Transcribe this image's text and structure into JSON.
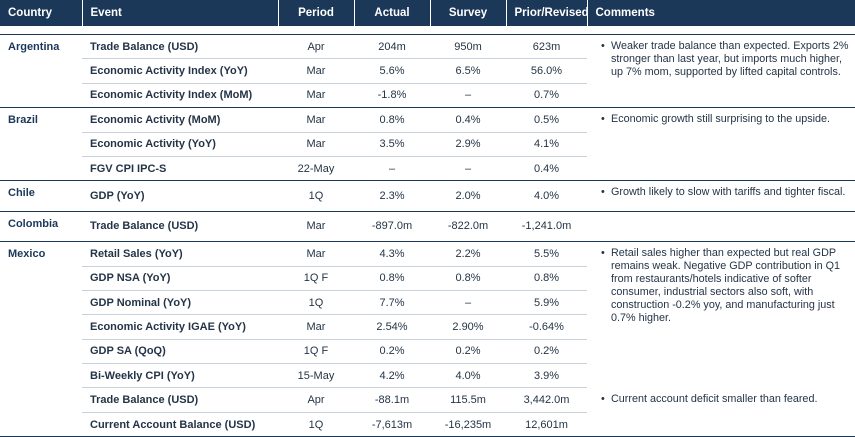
{
  "headers": {
    "country": "Country",
    "event": "Event",
    "period": "Period",
    "actual": "Actual",
    "survey": "Survey",
    "prior": "Prior/Revised",
    "comments": "Comments"
  },
  "groups": [
    {
      "country": "Argentina",
      "rows": [
        {
          "event": "Trade Balance (USD)",
          "period": "Apr",
          "actual": "204m",
          "survey": "950m",
          "prior": "623m"
        },
        {
          "event": "Economic Activity Index (YoY)",
          "period": "Mar",
          "actual": "5.6%",
          "survey": "6.5%",
          "prior": "56.0%"
        },
        {
          "event": "Economic Activity Index (MoM)",
          "period": "Mar",
          "actual": "-1.8%",
          "survey": "–",
          "prior": "0.7%"
        }
      ],
      "comments": [
        "Weaker trade balance than expected. Exports 2% stronger than last year, but imports much higher, up 7% mom, supported by lifted capital controls."
      ]
    },
    {
      "country": "Brazil",
      "rows": [
        {
          "event": "Economic Activity (MoM)",
          "period": "Mar",
          "actual": "0.8%",
          "survey": "0.4%",
          "prior": "0.5%"
        },
        {
          "event": "Economic Activity (YoY)",
          "period": "Mar",
          "actual": "3.5%",
          "survey": "2.9%",
          "prior": "4.1%"
        },
        {
          "event": "FGV CPI IPC-S",
          "period": "22-May",
          "actual": "–",
          "survey": "–",
          "prior": "0.4%"
        }
      ],
      "comments": [
        "Economic growth still surprising to the upside."
      ]
    },
    {
      "country": "Chile",
      "rows": [
        {
          "event": "GDP (YoY)",
          "period": "1Q",
          "actual": "2.3%",
          "survey": "2.0%",
          "prior": "4.0%"
        }
      ],
      "comments": [
        "Growth likely to slow with tariffs and tighter fiscal."
      ]
    },
    {
      "country": "Colombia",
      "rows": [
        {
          "event": "Trade Balance (USD)",
          "period": "Mar",
          "actual": "-897.0m",
          "survey": "-822.0m",
          "prior": "-1,241.0m"
        }
      ],
      "comments": []
    },
    {
      "country": "Mexico",
      "rows": [
        {
          "event": "Retail Sales (YoY)",
          "period": "Mar",
          "actual": "4.3%",
          "survey": "2.2%",
          "prior": "5.5%"
        },
        {
          "event": "GDP NSA (YoY)",
          "period": "1Q F",
          "actual": "0.8%",
          "survey": "0.8%",
          "prior": "0.8%"
        },
        {
          "event": "GDP Nominal (YoY)",
          "period": "1Q",
          "actual": "7.7%",
          "survey": "–",
          "prior": "5.9%"
        },
        {
          "event": "Economic Activity IGAE (YoY)",
          "period": "Mar",
          "actual": "2.54%",
          "survey": "2.90%",
          "prior": "-0.64%"
        },
        {
          "event": "GDP SA (QoQ)",
          "period": "1Q F",
          "actual": "0.2%",
          "survey": "0.2%",
          "prior": "0.2%"
        },
        {
          "event": "Bi-Weekly CPI (YoY)",
          "period": "15-May",
          "actual": "4.2%",
          "survey": "4.0%",
          "prior": "3.9%"
        },
        {
          "event": "Trade Balance (USD)",
          "period": "Apr",
          "actual": "-88.1m",
          "survey": "115.5m",
          "prior": "3,442.0m"
        },
        {
          "event": "Current Account Balance (USD)",
          "period": "1Q",
          "actual": "-7,613m",
          "survey": "-16,235m",
          "prior": "12,601m"
        }
      ],
      "comments": [
        "Retail sales higher than expected but real GDP remains weak. Negative GDP contribution in Q1 from restaurants/hotels indicative of softer consumer, industrial sectors also soft, with construction -0.2% yoy, and manufacturing just 0.7% higher.",
        "Current account deficit smaller than feared."
      ]
    }
  ]
}
